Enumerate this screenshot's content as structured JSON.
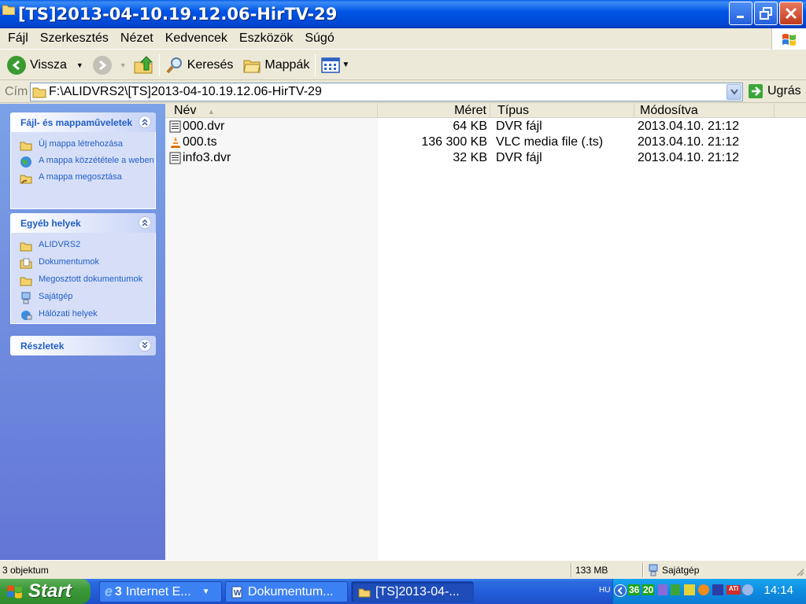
{
  "window": {
    "title": "[TS]2013-04-10.19.12.06-HirTV-29"
  },
  "menu": [
    "Fájl",
    "Szerkesztés",
    "Nézet",
    "Kedvencek",
    "Eszközök",
    "Súgó"
  ],
  "toolbar": {
    "back": "Vissza",
    "search": "Keresés",
    "folders": "Mappák"
  },
  "address": {
    "label": "Cím",
    "path": "F:\\ALIDVRS2\\[TS]2013-04-10.19.12.06-HirTV-29",
    "go": "Ugrás"
  },
  "taskpane": {
    "tasks": {
      "title": "Fájl- és mappaműveletek",
      "items": [
        "Új mappa létrehozása",
        "A mappa közzététele a weben",
        "A mappa megosztása"
      ]
    },
    "places": {
      "title": "Egyéb helyek",
      "items": [
        "ALIDVRS2",
        "Dokumentumok",
        "Megosztott dokumentumok",
        "Sajátgép",
        "Hálózati helyek"
      ]
    },
    "details": {
      "title": "Részletek"
    }
  },
  "columns": {
    "name": "Név",
    "size": "Méret",
    "type": "Típus",
    "modified": "Módosítva"
  },
  "files": [
    {
      "name": "000.dvr",
      "size": "64 KB",
      "type": "DVR fájl",
      "modified": "2013.04.10. 21:12",
      "icon": "dvr-file-icon"
    },
    {
      "name": "000.ts",
      "size": "136 300 KB",
      "type": "VLC media file (.ts)",
      "modified": "2013.04.10. 21:12",
      "icon": "vlc-cone-icon"
    },
    {
      "name": "info3.dvr",
      "size": "32 KB",
      "type": "DVR fájl",
      "modified": "2013.04.10. 21:12",
      "icon": "dvr-file-icon"
    }
  ],
  "status": {
    "count": "3 objektum",
    "size": "133 MB",
    "location": "Sajátgép"
  },
  "taskbar": {
    "start": "Start",
    "tasks": [
      {
        "count": "3",
        "label": "Internet E..."
      },
      {
        "label": "Dokumentum..."
      },
      {
        "label": "[TS]2013-04-..."
      }
    ],
    "tray": {
      "lang": "HU",
      "num1": "36",
      "num2": "20",
      "clock": "14:14"
    }
  },
  "colors": {
    "titlebar": "#0055e5",
    "taskpane": "#6375d6",
    "link": "#215dc6",
    "start": "#3c9a3a"
  }
}
